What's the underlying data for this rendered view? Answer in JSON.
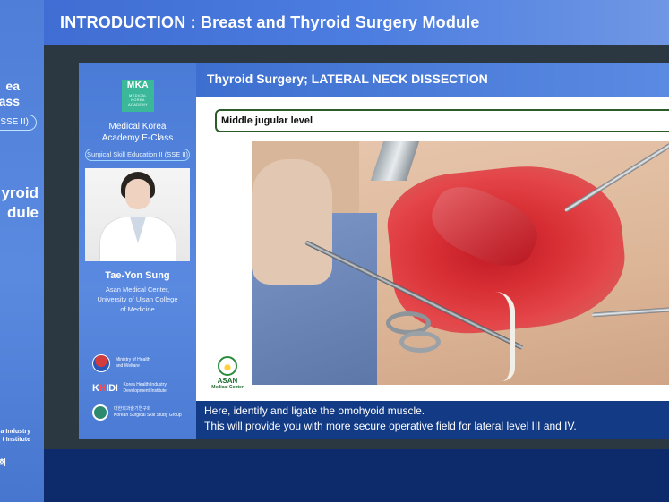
{
  "background": {
    "title": "INTRODUCTION : Breast and Thyroid Surgery Module",
    "strip_line1": "ea",
    "strip_line2": "ass",
    "strip_pill": "(SSE II)",
    "strip_module_line1": "yroid",
    "strip_module_line2": "dule",
    "strip_org_line1": "a Industry",
    "strip_org_line2": "t Institute",
    "strip_korean": "회"
  },
  "sidebar": {
    "logo_letters": "MKA",
    "logo_sub": "MEDICAL KOREA ACADEMY",
    "academy_title_line1": "Medical Korea",
    "academy_title_line2": "Academy E-Class",
    "program_pill": "Surgical Skill Education II (SSE II)",
    "speaker_name": "Tae-Yon Sung",
    "affiliation_line1": "Asan Medical Center,",
    "affiliation_line2": "University of Ulsan College",
    "affiliation_line3": "of Medicine",
    "logos": [
      {
        "line1": "Ministry of Health",
        "line2": "and Welfare"
      },
      {
        "mark_pre": "K",
        "mark_accent": "H",
        "mark_post": "IDI",
        "line1": "Korea Health Industry",
        "line2": "Development Institute"
      },
      {
        "line1": "대한외과술기연구회",
        "line2": "Korean Surgical Skill Study Group"
      }
    ]
  },
  "slide": {
    "section_title": "Thyroid Surgery; LATERAL NECK DISSECTION",
    "level_label": "Middle jugular level",
    "hospital_name": "ASAN",
    "hospital_sub": "Medical Center",
    "caption_line1": "Here, identify and ligate the omohyoid muscle.",
    "caption_line2": "This will provide you with more secure operative field for lateral level III and IV."
  },
  "colors": {
    "header_blue": "#4c7de0",
    "caption_navy": "#123a85",
    "level_border": "#2a5c2a",
    "asan_green": "#1c6b2a"
  }
}
